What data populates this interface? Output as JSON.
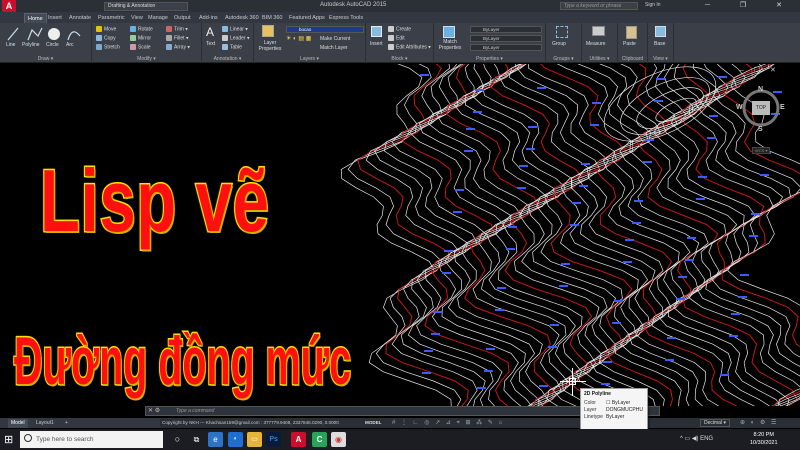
{
  "window": {
    "title": "Autodesk AutoCAD 2015",
    "workspace": "Drafting & Annotation",
    "search_placeholder": "Type a keyword or phrase",
    "signin": "Sign In",
    "controls": "─ ❐ ✕",
    "logo": "A"
  },
  "tabs": [
    "Home",
    "Insert",
    "Annotate",
    "Parametric",
    "View",
    "Manage",
    "Output",
    "Add-ins",
    "Autodesk 360",
    "BIM 360",
    "Featured Apps",
    "Express Tools"
  ],
  "ribbon": {
    "draw": {
      "label": "Draw ▾",
      "line": "Line",
      "polyline": "Polyline",
      "circle": "Circle",
      "arc": "Arc"
    },
    "modify": {
      "label": "Modify ▾",
      "move": "Move",
      "rotate": "Rotate",
      "trim": "Trim ▾",
      "copy": "Copy",
      "mirror": "Mirror",
      "fillet": "Fillet ▾",
      "stretch": "Stretch",
      "scale": "Scale",
      "array": "Array ▾"
    },
    "annotation": {
      "label": "Annotation ▾",
      "text": "Text",
      "linear": "Linear ▾",
      "leader": "Leader ▾",
      "table": "Table"
    },
    "layers": {
      "label": "Layers ▾",
      "properties": "Layer Properties",
      "current_layer": "bocao",
      "make_current": "Make Current",
      "match_layer": "Match Layer"
    },
    "block": {
      "label": "Block ▾",
      "insert": "Insert",
      "create": "Create",
      "edit": "Edit",
      "edit_attributes": "Edit Attributes ▾"
    },
    "properties": {
      "label": "Properties ▾",
      "match": "Match Properties",
      "color": "ByLayer",
      "lineweight": "ByLayer",
      "linetype": "ByLayer"
    },
    "groups": {
      "label": "Groups ▾",
      "group": "Group"
    },
    "utilities": {
      "label": "Utilities ▾",
      "measure": "Measure"
    },
    "clipboard": {
      "label": "Clipboard",
      "paste": "Paste"
    },
    "view": {
      "label": "View ▾",
      "base": "Base"
    }
  },
  "headline": {
    "line1": "Lisp vẽ",
    "line2": "Đường đồng mức"
  },
  "viewcube": {
    "n": "N",
    "w": "W",
    "e": "E",
    "s": "S",
    "top": "TOP",
    "wcs": "WCS ▾"
  },
  "canvas_controls": "– ☐ ✕",
  "command_line": {
    "close": "✕ ⚙",
    "placeholder": "Type a command"
  },
  "layouts": [
    "Model",
    "Layout1",
    "+"
  ],
  "status": {
    "copyright": "Copyright by NKH --- Khachsan159@gmail.com :",
    "coords": "377779.9408, 2337848.0290, 0.0000",
    "space": "MODEL",
    "icons": "# ⋮ ∟ ◎ ↗ ⊿ ⌖ ⊞ ⁂ ✎ ⌂",
    "units": "Decimal ▾",
    "right_icons": "⊕ ◐ ⚙ ☰"
  },
  "tooltip": {
    "title": "2D Polyline",
    "rows": [
      {
        "key": "Color",
        "value": "☐ ByLayer"
      },
      {
        "key": "Layer",
        "value": "DONGMUCPHU"
      },
      {
        "key": "Linetype",
        "value": "ByLayer"
      }
    ]
  },
  "taskbar": {
    "start": "⊞",
    "search": "Type here to search",
    "tray": "^ ▭ ◀) ENG",
    "time": "8:20 PM",
    "date": "10/30/2021"
  },
  "colors": {
    "contour_white": "#e8e8e8",
    "contour_red": "#c41818",
    "label_blue": "#3a5cff",
    "headline_fill": "#ff1010",
    "headline_outline": "#ffe000"
  }
}
